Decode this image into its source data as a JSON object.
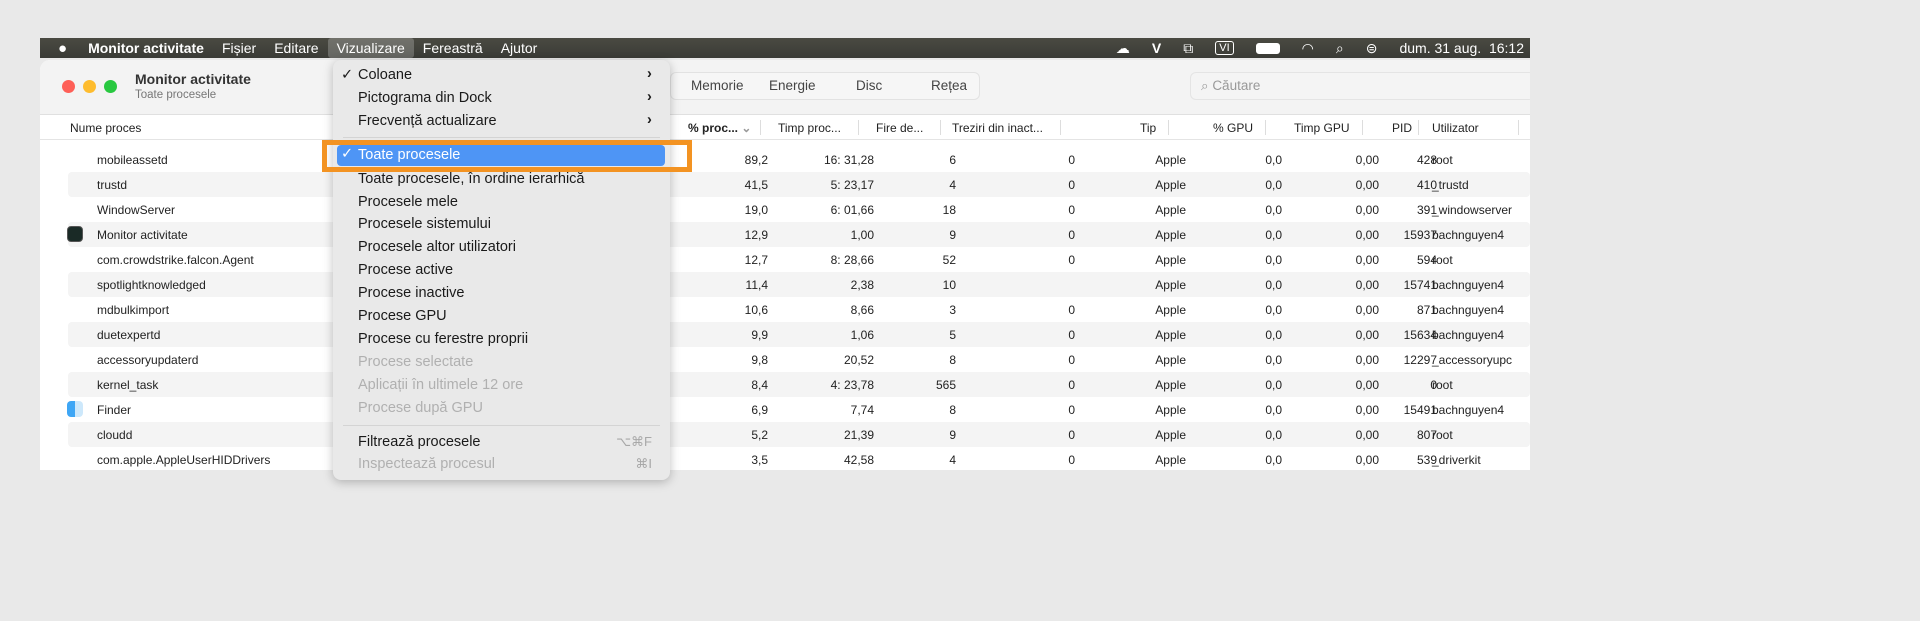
{
  "menubar": {
    "app": "Monitor activitate",
    "items": [
      "Fișier",
      "Editare",
      "Vizualizare",
      "Fereastră",
      "Ajutor"
    ],
    "input_source": "VI",
    "clock": "dum. 31 aug.  16:12"
  },
  "window": {
    "title": "Monitor activitate",
    "subtitle": "Toate procesele",
    "tabs": [
      "Memorie",
      "Energie",
      "Disc",
      "Rețea"
    ],
    "search_placeholder": "Căutare"
  },
  "columns": [
    "Nume proces",
    "% proc...",
    "Timp proc...",
    "Fire de...",
    "Treziri din inact...",
    "Tip",
    "% GPU",
    "Timp GPU",
    "PID",
    "Utilizator"
  ],
  "rows": [
    [
      "mobileassetd",
      "89,2",
      "16: 31,28",
      "6",
      "0",
      "Apple",
      "0,0",
      "0,00",
      "428",
      "root"
    ],
    [
      "trustd",
      "41,5",
      "5: 23,17",
      "4",
      "0",
      "Apple",
      "0,0",
      "0,00",
      "410",
      "_trustd"
    ],
    [
      "WindowServer",
      "19,0",
      "6: 01,66",
      "18",
      "0",
      "Apple",
      "0,0",
      "0,00",
      "391",
      "_windowserver"
    ],
    [
      "Monitor activitate",
      "12,9",
      "1,00",
      "9",
      "0",
      "Apple",
      "0,0",
      "0,00",
      "15937",
      "bachnguyen4"
    ],
    [
      "com.crowdstrike.falcon.Agent",
      "12,7",
      "8: 28,66",
      "52",
      "0",
      "Apple",
      "0,0",
      "0,00",
      "594",
      "root"
    ],
    [
      "spotlightknowledged",
      "11,4",
      "2,38",
      "10",
      "",
      "Apple",
      "0,0",
      "0,00",
      "15741",
      "bachnguyen4"
    ],
    [
      "mdbulkimport",
      "10,6",
      "8,66",
      "3",
      "0",
      "Apple",
      "0,0",
      "0,00",
      "871",
      "bachnguyen4"
    ],
    [
      "duetexpertd",
      "9,9",
      "1,06",
      "5",
      "0",
      "Apple",
      "0,0",
      "0,00",
      "15634",
      "bachnguyen4"
    ],
    [
      "accessoryupdaterd",
      "9,8",
      "20,52",
      "8",
      "0",
      "Apple",
      "0,0",
      "0,00",
      "12297",
      "_accessoryupc"
    ],
    [
      "kernel_task",
      "8,4",
      "4: 23,78",
      "565",
      "0",
      "Apple",
      "0,0",
      "0,00",
      "0",
      "root"
    ],
    [
      "Finder",
      "6,9",
      "7,74",
      "8",
      "0",
      "Apple",
      "0,0",
      "0,00",
      "15491",
      "bachnguyen4"
    ],
    [
      "cloudd",
      "5,2",
      "21,39",
      "9",
      "0",
      "Apple",
      "0,0",
      "0,00",
      "807",
      "root"
    ],
    [
      "com.apple.AppleUserHIDDrivers",
      "3,5",
      "42,58",
      "4",
      "0",
      "Apple",
      "0,0",
      "0,00",
      "539",
      "_driverkit"
    ]
  ],
  "menu": {
    "items": [
      {
        "label": "Coloane",
        "checked": true,
        "submenu": true
      },
      {
        "label": "Pictograma din Dock",
        "submenu": true
      },
      {
        "label": "Frecvență actualizare",
        "submenu": true
      },
      {
        "label": "Toate procesele",
        "checked": true,
        "selected": true
      },
      {
        "label": "Toate procesele, în ordine ierarhică"
      },
      {
        "label": "Procesele mele"
      },
      {
        "label": "Procesele sistemului"
      },
      {
        "label": "Procesele altor utilizatori"
      },
      {
        "label": "Procese active"
      },
      {
        "label": "Procese inactive"
      },
      {
        "label": "Procese GPU"
      },
      {
        "label": "Procese cu ferestre proprii"
      },
      {
        "label": "Procese selectate",
        "disabled": true
      },
      {
        "label": "Aplicații în ultimele 12 ore",
        "disabled": true
      },
      {
        "label": "Procese după GPU",
        "disabled": true
      },
      {
        "label": "Filtrează procesele",
        "shortcut": "⌥⌘F"
      },
      {
        "label": "Inspectează procesul",
        "shortcut": "⌘I",
        "disabled": true
      }
    ],
    "check": "✓",
    "arrow": "›"
  },
  "colors": {
    "highlight": "#4e95f5",
    "annotation": "#f39322"
  }
}
